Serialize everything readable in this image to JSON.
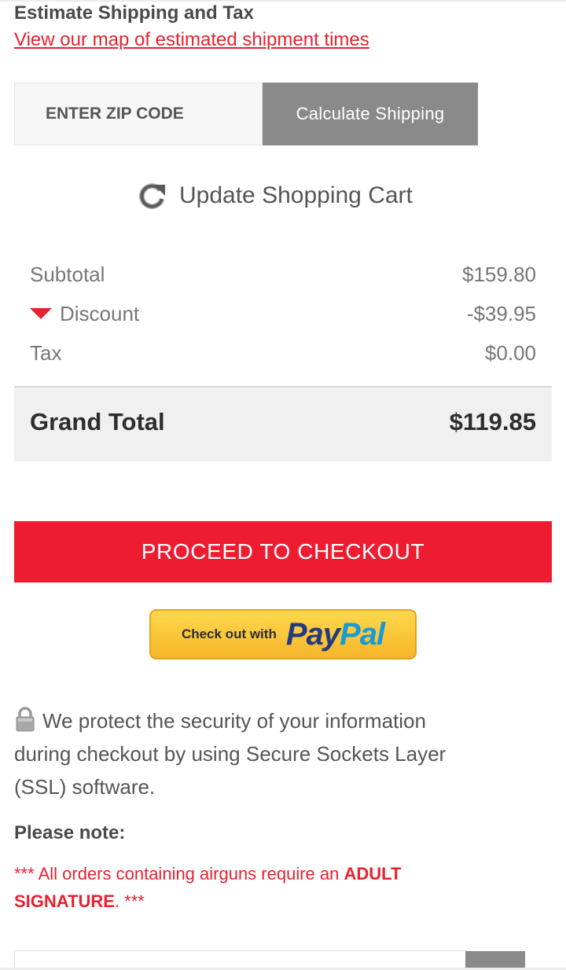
{
  "shipping": {
    "title": "Estimate Shipping and Tax",
    "map_link": "View our map of estimated shipment times",
    "zip_placeholder": "ENTER ZIP CODE",
    "calculate_label": "Calculate Shipping"
  },
  "cart": {
    "update_label": "Update Shopping Cart"
  },
  "totals": {
    "subtotal_label": "Subtotal",
    "subtotal_value": "$159.80",
    "discount_label": "Discount",
    "discount_value": "-$39.95",
    "tax_label": "Tax",
    "tax_value": "$0.00",
    "grand_total_label": "Grand Total",
    "grand_total_value": "$119.85"
  },
  "checkout": {
    "proceed_label": "PROCEED TO CHECKOUT",
    "paypal_prefix": "Check out with",
    "paypal_pay": "Pay",
    "paypal_pal": "Pal"
  },
  "security": {
    "text": "We protect the security of your information during checkout by using Secure Sockets Layer (SSL) software."
  },
  "notes": {
    "heading": "Please note:",
    "adult_prefix": "*** All orders containing airguns require an ",
    "adult_emphasis": "ADULT SIGNATURE",
    "adult_suffix": ". ***"
  },
  "colors": {
    "accent_red": "#ed1c31",
    "button_gray": "#8a8a8a",
    "paypal_yellow": "#ffc439"
  },
  "icons": [
    "refresh-icon",
    "discount-toggle-icon",
    "lock-icon"
  ]
}
